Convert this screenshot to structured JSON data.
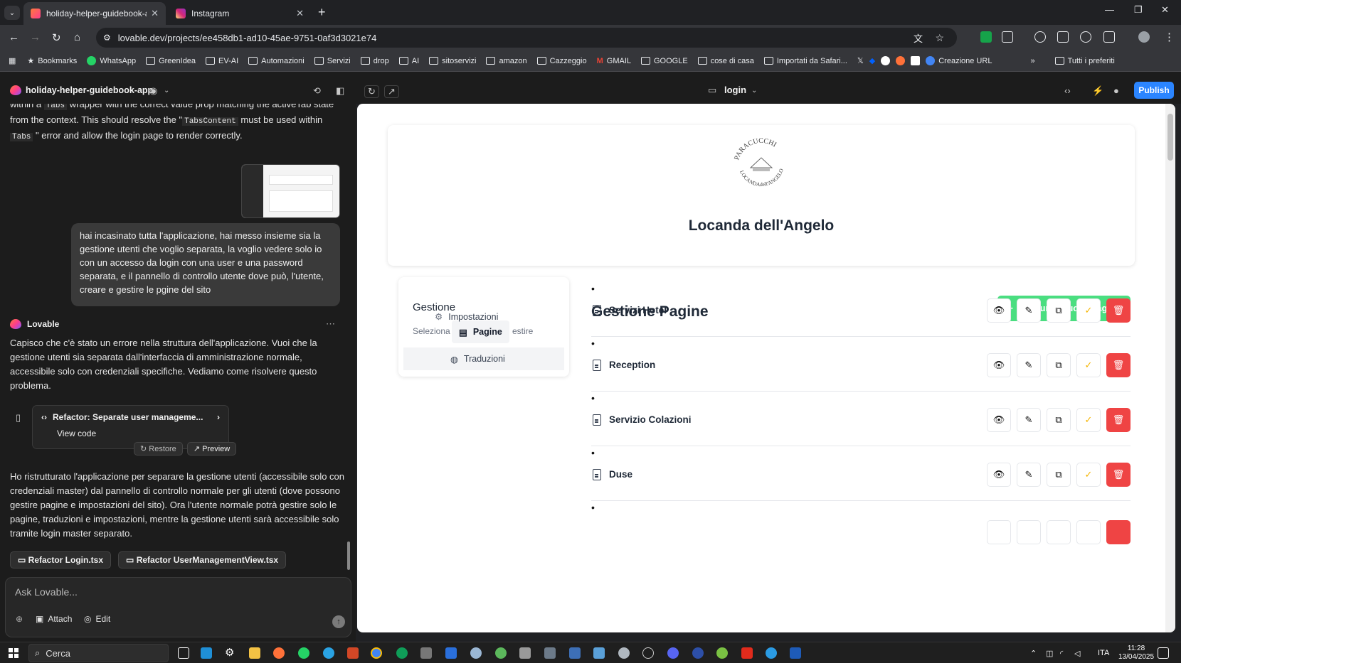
{
  "browser": {
    "tabs": [
      {
        "title": "holiday-helper-guidebook-app",
        "favicon_color": "#ff5a6e"
      },
      {
        "title": "Instagram",
        "favicon_color": "#e1306c"
      }
    ],
    "url": "lovable.dev/projects/ee458db1-ad10-45ae-9751-0af3d3021e74",
    "bookmarks": [
      "Bookmarks",
      "WhatsApp",
      "GreenIdea",
      "EV-AI",
      "Automazioni",
      "Servizi",
      "drop",
      "AI",
      "sitoservizi",
      "amazon",
      "Cazzeggio",
      "GMAIL",
      "GOOGLE",
      "cose di casa",
      "Importati da Safari...",
      "Creazione URL",
      "Tutti i preferiti"
    ]
  },
  "lovable": {
    "project_name": "holiday-helper-guidebook-app",
    "route": "login",
    "publish_label": "Publish"
  },
  "chat": {
    "top_text_1": "within a",
    "top_code_1": "Tabs",
    "top_text_2": "wrapper with the correct value prop matching the activeTab state from the context. This should resolve the \"",
    "top_code_2": "TabsContent",
    "top_text_3": "must be used within",
    "top_code_3": "Tabs",
    "top_text_4": "\" error and allow the login page to render correctly.",
    "user_message": "hai incasinato tutta l'applicazione, hai messo insieme sia la gestione utenti che voglio separata, la voglio vedere solo io con un accesso da login con una user e una password separata, e il pannello di controllo utente dove può, l'utente,  creare e gestire le pgine del sito",
    "ai_name": "Lovable",
    "ai_intro": "Capisco che c'è stato un errore nella struttura dell'applicazione. Vuoi che la gestione utenti sia separata dall'interfaccia di amministrazione normale, accessibile solo con credenziali specifiche. Vediamo come risolvere questo problema.",
    "card_title": "Refactor: Separate user manageme...",
    "card_view": "View code",
    "restore_label": "Restore",
    "preview_label": "Preview",
    "ai_summary": "Ho ristrutturato l'applicazione per separare la gestione utenti (accessibile solo con credenziali master) dal pannello di controllo normale per gli utenti (dove possono gestire pagine e impostazioni del sito). Ora l'utente normale potrà gestire solo le pagine, traduzioni e impostazioni, mentre la gestione utenti sarà accessibile solo tramite login master separato.",
    "files": [
      "Refactor Login.tsx",
      "Refactor UserManagementView.tsx"
    ],
    "input_placeholder": "Ask Lovable...",
    "attach_label": "Attach",
    "edit_label": "Edit"
  },
  "preview": {
    "seal_top": "PARACUCCHI",
    "seal_bottom": "LOCANDAdell'ANGELO",
    "hero_title": "Locanda dell'Angelo",
    "sidebar": {
      "title": "Gestione",
      "subtitle_start": "Seleziona",
      "subtitle_end": "estire",
      "tab_pagine": "Pagine",
      "tab_traduzioni": "Traduzioni",
      "tab_impostazioni": "Impostazioni"
    },
    "main_title": "Gestione Pagine",
    "add_button": "Aggiungi Nuova Pagina",
    "pages": [
      "Servizi Hotel",
      "Reception",
      "Servizio Colazioni",
      "Duse"
    ]
  },
  "taskbar": {
    "search_placeholder": "Cerca",
    "lang": "ITA",
    "time": "11:28",
    "date": "13/04/2025"
  },
  "colors": {
    "publish": "#2b85ff",
    "add_button": "#4ade80",
    "delete": "#ef4444",
    "check": "#f5b400"
  }
}
